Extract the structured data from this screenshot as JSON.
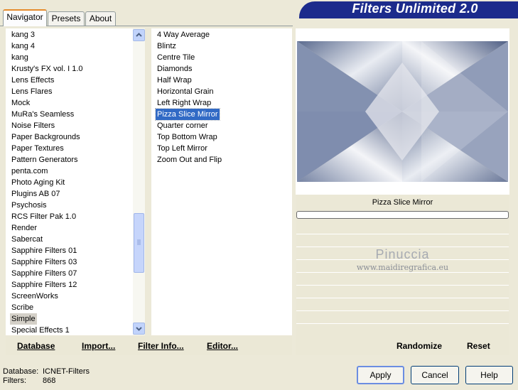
{
  "window": {
    "title": "Filters Unlimited 2.0"
  },
  "tabs": [
    {
      "label": "Navigator",
      "active": true
    },
    {
      "label": "Presets",
      "active": false
    },
    {
      "label": "About",
      "active": false
    }
  ],
  "categories": [
    "kang 3",
    "kang 4",
    "kang",
    "Krusty's FX vol. I 1.0",
    "Lens Effects",
    "Lens Flares",
    "Mock",
    "MuRa's Seamless",
    "Noise Filters",
    "Paper Backgrounds",
    "Paper Textures",
    "Pattern Generators",
    "penta.com",
    "Photo Aging Kit",
    "Plugins AB 07",
    "Psychosis",
    "RCS Filter Pak 1.0",
    "Render",
    "Sabercat",
    "Sapphire Filters 01",
    "Sapphire Filters 03",
    "Sapphire Filters 07",
    "Sapphire Filters 12",
    "ScreenWorks",
    "Scribe",
    "Simple",
    "Special Effects 1"
  ],
  "selected_category_index": 25,
  "filters": [
    "4 Way Average",
    "Blintz",
    "Centre Tile",
    "Diamonds",
    "Half Wrap",
    "Horizontal Grain",
    "Left Right Wrap",
    "Pizza Slice Mirror",
    "Quarter corner",
    "Top Bottom Wrap",
    "Top Left Mirror",
    "Zoom Out and Flip"
  ],
  "selected_filter_index": 7,
  "preview": {
    "filter_name": "Pizza Slice Mirror",
    "progress": 0
  },
  "watermark": {
    "name": "Pinuccia",
    "url": "www.maidiregrafica.eu"
  },
  "bottom_links": {
    "database": "Database",
    "import": "Import...",
    "filter_info": "Filter Info...",
    "editor": "Editor...",
    "randomize": "Randomize",
    "reset": "Reset"
  },
  "info": {
    "database_label": "Database:",
    "database_value": "ICNET-Filters",
    "filters_label": "Filters:",
    "filters_value": "868"
  },
  "buttons": {
    "apply": "Apply",
    "cancel": "Cancel",
    "help": "Help"
  },
  "colors": {
    "banner": "#1c2b8c",
    "selection": "#316ac5",
    "tab_highlight": "#e68b2c"
  }
}
